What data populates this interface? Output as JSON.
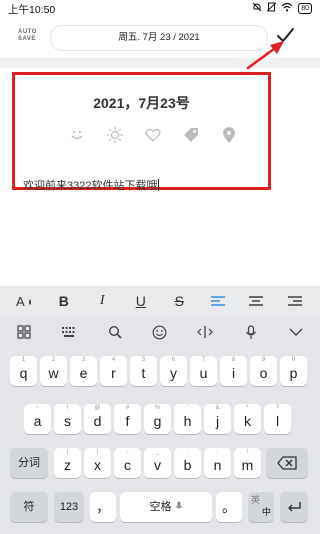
{
  "status": {
    "time": "上午10:50",
    "battery": "80"
  },
  "toolbar": {
    "autosave_line1": "AUTO",
    "autosave_line2": "SAVE",
    "date": "周五. 7月 23 / 2021"
  },
  "editor": {
    "date_heading": "2021，7月23号",
    "body": "欢迎前来3322软件站下载哦",
    "mood_icons": [
      "smile-icon",
      "sun-icon",
      "heart-icon",
      "tag-icon",
      "location-icon"
    ]
  },
  "format_bar": {
    "items": [
      "text-size-color-icon",
      "bold-icon",
      "italic-icon",
      "underline-icon",
      "strikethrough-icon",
      "align-left-icon",
      "align-center-icon",
      "align-right-icon"
    ],
    "active": "align-left-icon",
    "bold": "B",
    "italic": "I",
    "underline": "U",
    "strike": "S"
  },
  "keyboard": {
    "tools": [
      "grid-icon",
      "keyboard-icon",
      "search-icon",
      "emoji-icon",
      "cursor-icon",
      "mic-icon",
      "collapse-icon"
    ],
    "row1": [
      {
        "k": "q",
        "h": "1"
      },
      {
        "k": "w",
        "h": "2"
      },
      {
        "k": "e",
        "h": "3"
      },
      {
        "k": "r",
        "h": "4"
      },
      {
        "k": "t",
        "h": "5"
      },
      {
        "k": "y",
        "h": "6"
      },
      {
        "k": "u",
        "h": "7"
      },
      {
        "k": "i",
        "h": "8"
      },
      {
        "k": "o",
        "h": "9"
      },
      {
        "k": "p",
        "h": "0"
      }
    ],
    "row2": [
      {
        "k": "a",
        "h": "~"
      },
      {
        "k": "s",
        "h": "!"
      },
      {
        "k": "d",
        "h": "@"
      },
      {
        "k": "f",
        "h": "#"
      },
      {
        "k": "g",
        "h": "%"
      },
      {
        "k": "h",
        "h": "'"
      },
      {
        "k": "j",
        "h": "&"
      },
      {
        "k": "k",
        "h": "*"
      },
      {
        "k": "l",
        "h": "?"
      }
    ],
    "row3_left": "分词",
    "row3": [
      {
        "k": "z",
        "h": "("
      },
      {
        "k": "x",
        "h": ")"
      },
      {
        "k": "c",
        "h": "-"
      },
      {
        "k": "v",
        "h": "_"
      },
      {
        "k": "b",
        "h": ":"
      },
      {
        "k": "n",
        "h": ";"
      },
      {
        "k": "m",
        "h": "/"
      }
    ],
    "symbol": "符",
    "num": "123",
    "comma": "，",
    "space": "空格",
    "period": "。",
    "lang_top": "英",
    "lang_bottom": "中"
  }
}
